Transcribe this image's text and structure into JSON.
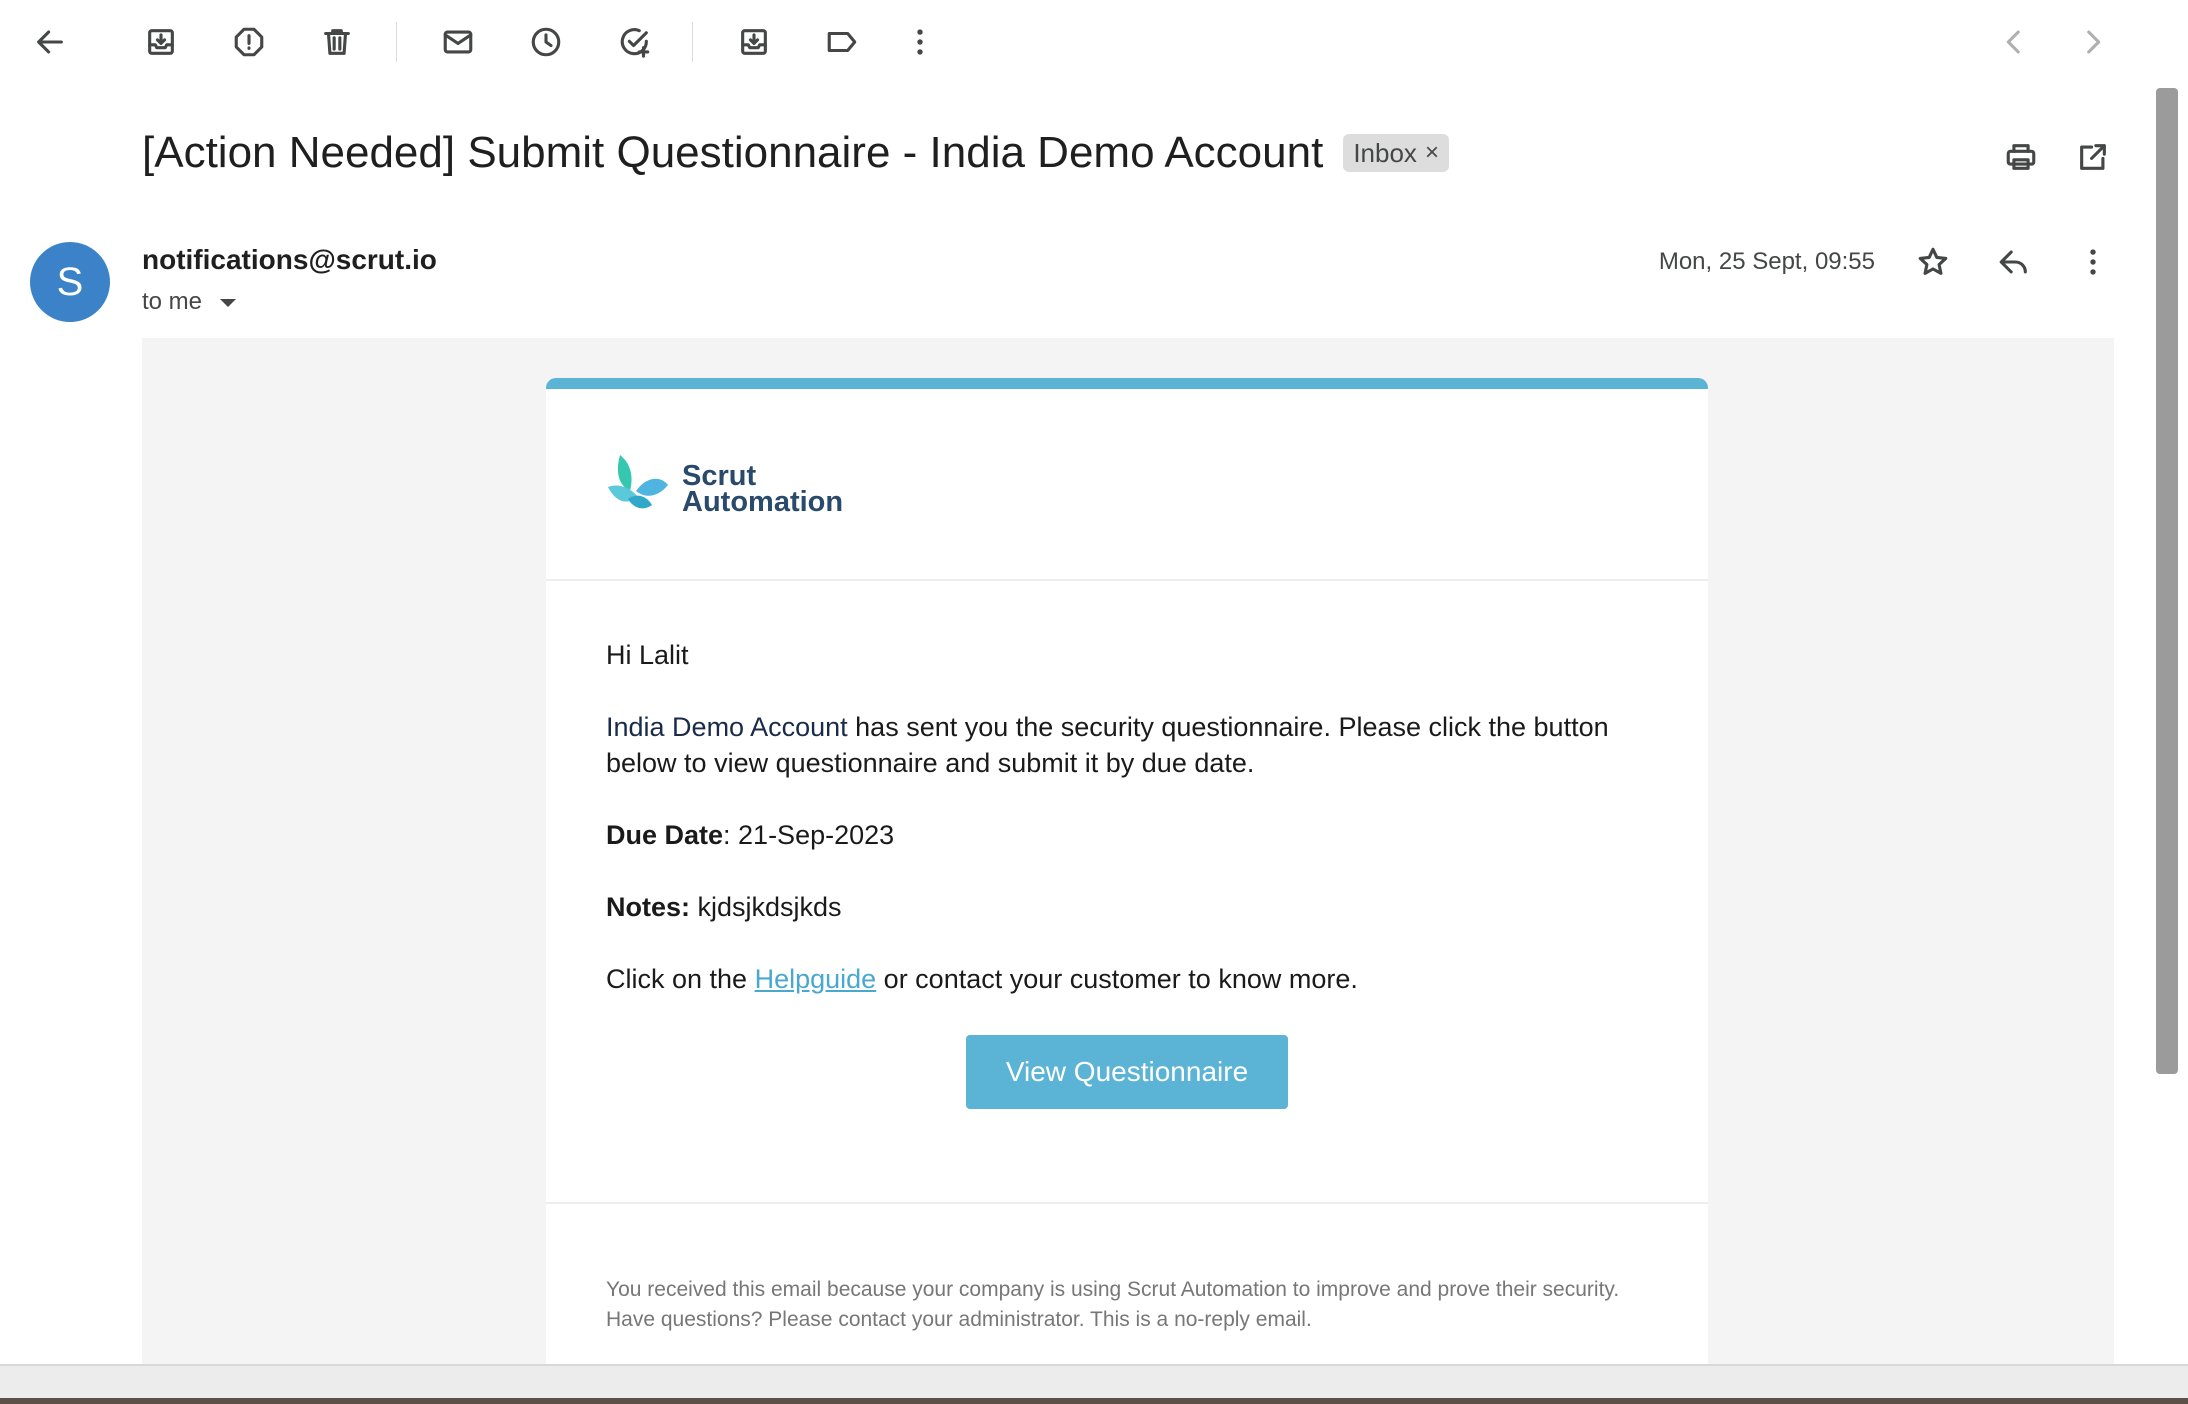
{
  "toolbar": {
    "icons": [
      "back-arrow-icon",
      "archive-icon",
      "report-spam-icon",
      "delete-icon",
      "mark-unread-icon",
      "snooze-icon",
      "add-task-icon",
      "move-to-icon",
      "label-icon",
      "more-vert-icon",
      "chevron-left-icon",
      "chevron-right-icon"
    ]
  },
  "email": {
    "subject": "[Action Needed] Submit Questionnaire - India Demo Account",
    "label": "Inbox",
    "label_close": "×",
    "sender_initial": "S",
    "sender": "notifications@scrut.io",
    "to": "to me",
    "date": "Mon, 25 Sept, 09:55"
  },
  "message": {
    "logo_line1": "Scrut",
    "logo_line2": "Automation",
    "greeting": "Hi Lalit",
    "account": "India Demo Account",
    "intro_rest": " has sent you the security questionnaire. Please click the button below to view questionnaire and submit it by due date.",
    "due_label": "Due Date",
    "due_value": ": 21-Sep-2023",
    "notes_label": "Notes:",
    "notes_value": " kjdsjkdsjkds",
    "click_prefix": "Click on the ",
    "helpguide": "Helpguide",
    "click_suffix": " or contact your customer to know more.",
    "cta": "View Questionnaire",
    "footer": "You received this email because your company is using Scrut Automation to improve and prove their security. Have questions? Please contact your administrator. This is a no-reply email."
  },
  "colors": {
    "accent": "#5bb4d6",
    "avatar": "#3b82c8",
    "logo_text": "#2a4a6b"
  }
}
